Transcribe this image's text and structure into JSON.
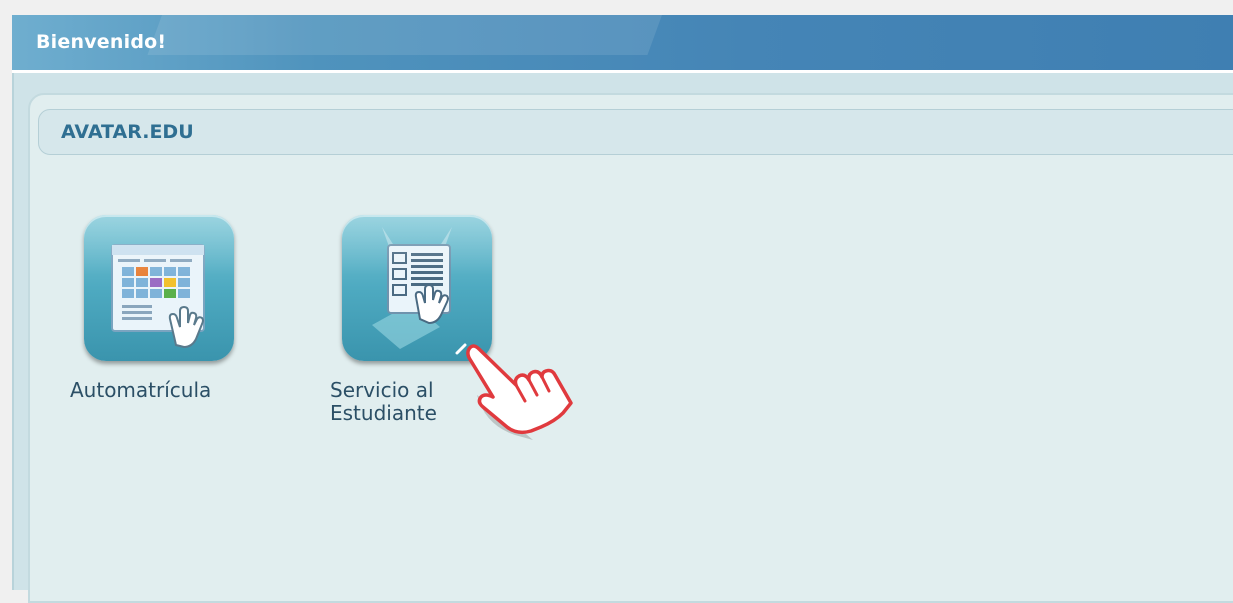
{
  "header": {
    "title": "Bienvenido!"
  },
  "section": {
    "title": "AVATAR.EDU"
  },
  "apps": [
    {
      "label": "Automatrícula",
      "icon": "calendar-schedule-icon"
    },
    {
      "label_line1": "Servicio al",
      "label_line2": "Estudiante",
      "icon": "student-service-document-icon"
    }
  ],
  "colors": {
    "header_blue": "#4585b6",
    "panel_bg": "#e1eeef",
    "section_title": "#2f6f92",
    "icon_teal": "#4eaac1",
    "cursor_red": "#e03a3e"
  }
}
